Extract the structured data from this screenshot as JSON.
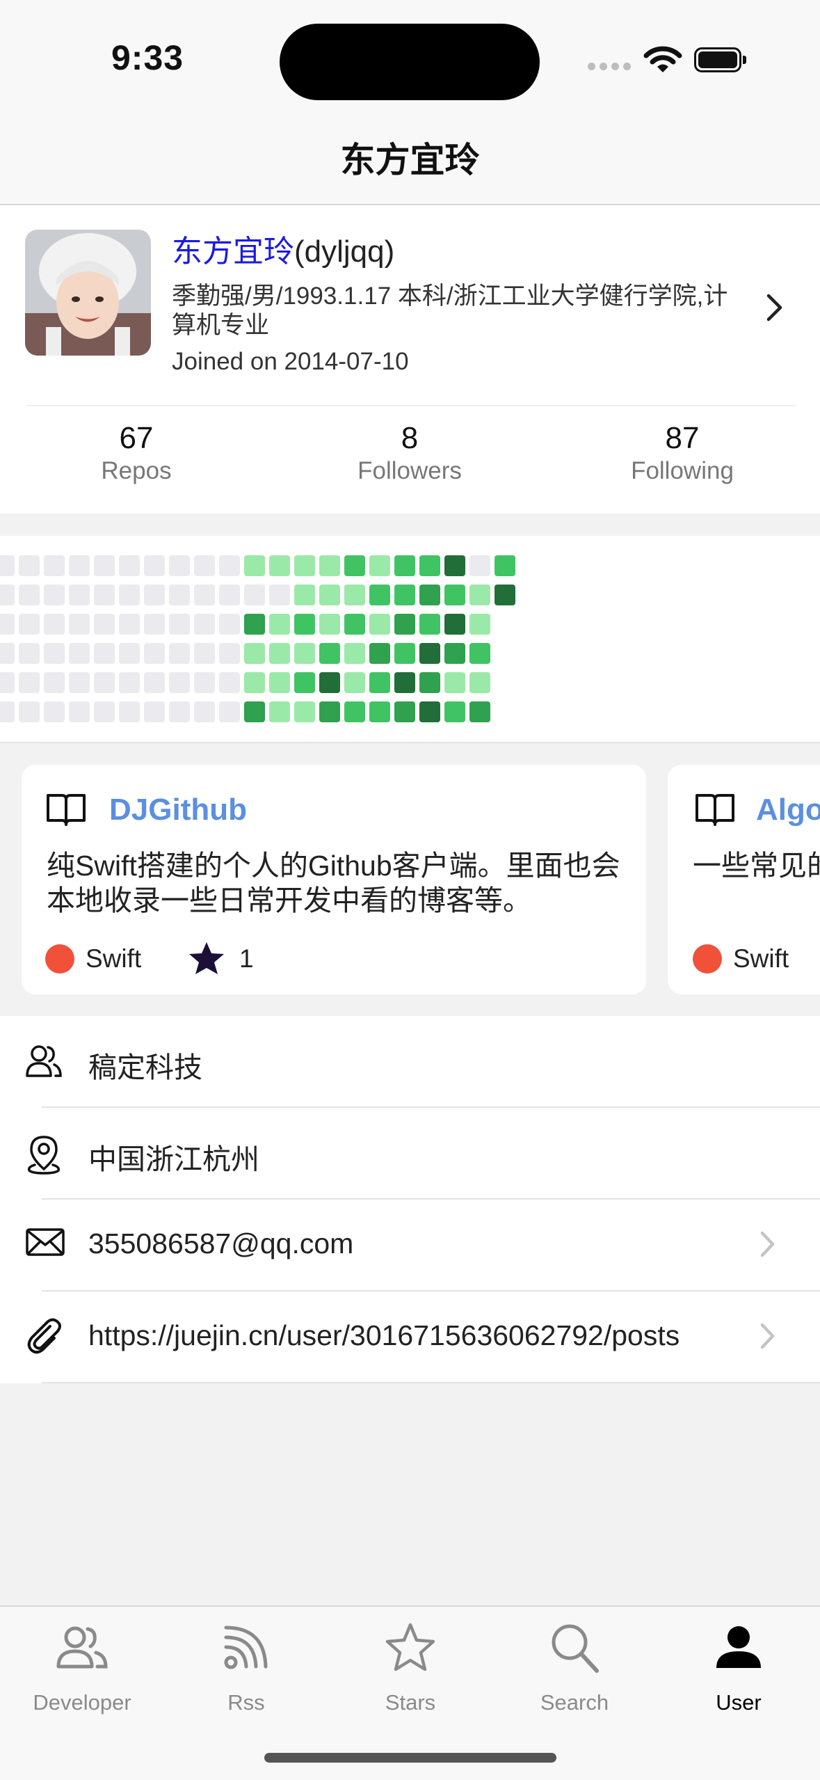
{
  "status_bar": {
    "time": "9:33"
  },
  "nav": {
    "title": "东方宜玲"
  },
  "profile": {
    "name": "东方宜玲",
    "login": "(dyljqq)",
    "bio": "季勤强/男/1993.1.17 本科/浙江工业大学健行学院,计算机专业",
    "joined": "Joined on 2014-07-10",
    "stats": [
      {
        "value": "67",
        "label": "Repos"
      },
      {
        "value": "8",
        "label": "Followers"
      },
      {
        "value": "87",
        "label": "Following"
      }
    ]
  },
  "colors": {
    "contrib_levels": [
      "#ebebef",
      "#9be9a8",
      "#40c463",
      "#30a14e",
      "#216e39"
    ],
    "link_blue": "#1a1ae8",
    "repo_name": "#5b8fe0",
    "swift": "#f05138"
  },
  "repos": [
    {
      "name": "DJGithub",
      "description": "纯Swift搭建的个人的Github客户端。里面也会本地收录一些日常开发中看的博客等。",
      "language": "Swift",
      "stars": "1",
      "icon": "book-icon"
    },
    {
      "name": "Algo",
      "description": "一些常见的",
      "language": "Swift",
      "stars": "",
      "icon": "book-icon"
    }
  ],
  "info": [
    {
      "icon": "company-icon",
      "text": "稿定科技",
      "chevron": false
    },
    {
      "icon": "location-icon",
      "text": "中国浙江杭州",
      "chevron": false
    },
    {
      "icon": "mail-icon",
      "text": "355086587@qq.com",
      "chevron": true
    },
    {
      "icon": "link-icon",
      "text": "https://juejin.cn/user/3016715636062792/posts",
      "chevron": true
    }
  ],
  "tabs": [
    {
      "label": "Developer",
      "icon": "people-icon",
      "active": false
    },
    {
      "label": "Rss",
      "icon": "rss-icon",
      "active": false
    },
    {
      "label": "Stars",
      "icon": "star-icon",
      "active": false
    },
    {
      "label": "Search",
      "icon": "search-icon",
      "active": false
    },
    {
      "label": "User",
      "icon": "user-icon",
      "active": true
    }
  ]
}
